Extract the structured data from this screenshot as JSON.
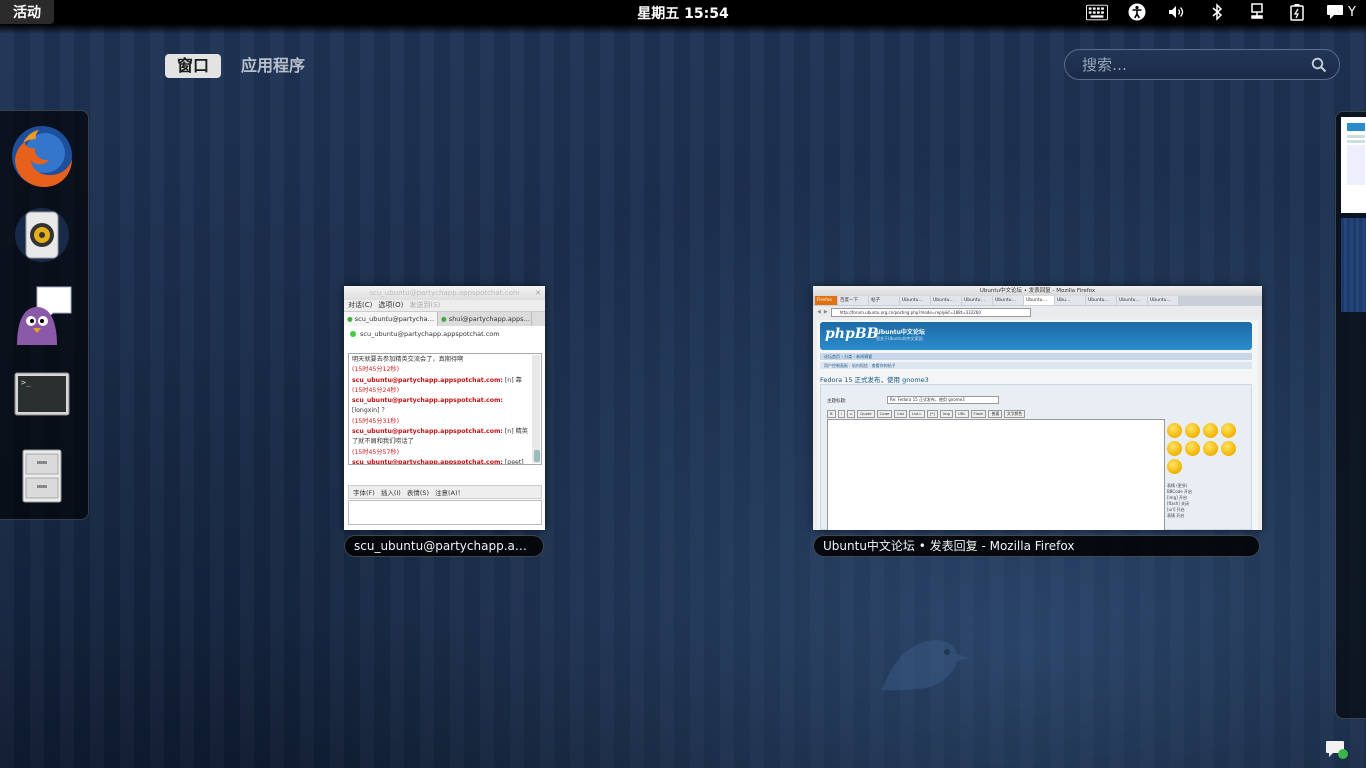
{
  "topbar": {
    "activities": "活动",
    "clock": "星期五 15:54",
    "user": "Y",
    "tray_icons": [
      "keyboard-icon",
      "accessibility-icon",
      "volume-icon",
      "bluetooth-icon",
      "network-icon",
      "battery-icon",
      "chat-status-icon"
    ]
  },
  "view_selector": {
    "windows": "窗口",
    "applications": "应用程序",
    "active": "windows"
  },
  "search": {
    "placeholder": "搜索…"
  },
  "dash": [
    "firefox-icon",
    "rhythmbox-icon",
    "pidgin-icon",
    "terminal-icon",
    "file-manager-icon"
  ],
  "windows": [
    {
      "caption": "scu_ubuntu@partychapp.appsp…",
      "title": "scu_ubuntu@partychapp.appspotchat.com",
      "menu": [
        "对话(C)",
        "选项(O)",
        "发送到(S)"
      ],
      "tabs": [
        "scu_ubuntu@partycha…",
        "shui@partychapp.apps…"
      ],
      "header": "scu_ubuntu@partychapp.appspotchat.com",
      "log": [
        {
          "type": "text",
          "text": "明天就要去参加精英交流会了，真期待啊"
        },
        {
          "type": "ts",
          "text": "(15时45分12秒)"
        },
        {
          "type": "msg",
          "nick": "scu_ubuntu@partychapp.appspotchat.com:",
          "text": " [n] 靠"
        },
        {
          "type": "ts",
          "text": "(15时45分24秒)"
        },
        {
          "type": "msg",
          "nick": "scu_ubuntu@partychapp.appspotchat.com:",
          "text": ""
        },
        {
          "type": "text",
          "text": "[longxin] ？"
        },
        {
          "type": "ts",
          "text": "(15时45分31秒)"
        },
        {
          "type": "msg",
          "nick": "scu_ubuntu@partychapp.appspotchat.com:",
          "text": " [n] 精英"
        },
        {
          "type": "text",
          "text": "了就不屑和我们唠话了"
        },
        {
          "type": "ts",
          "text": "(15时45分57秒)"
        },
        {
          "type": "msg",
          "nick": "scu_ubuntu@partychapp.appspotchat.com:",
          "text": " [peet] 廢"
        },
        {
          "type": "text",
          "text": "話里的精英"
        }
      ],
      "toolbar": [
        "字体(F)",
        "插入(I)",
        "表情(S)",
        "注意(A)！"
      ]
    },
    {
      "caption": "Ubuntu中文论坛 • 发表回复 - Mozilla Firefox",
      "title": "Ubuntu中文论坛 • 发表回复 - Mozilla Firefox",
      "menu_button": "Firefox",
      "tabs": [
        "百度一下",
        "帖子",
        "Ubuntu…",
        "Ubuntu…",
        "Ubuntu…",
        "Ubuntu…",
        "Ubuntu…",
        "Ubu…",
        "Ubuntu…",
        "Ubuntu…",
        "Ubuntu…"
      ],
      "url": "http://forum.ubuntu.org.cn/posting.php?mode=reply&f=188t=332260",
      "logo": "phpBB",
      "forum_name": "Ubuntu中文论坛",
      "forum_sub": "您关于Ubuntu的中文家园",
      "breadcrumb": "论坛首页 ‹ 分类 ‹ 新闻摘要",
      "navbar": "用户控制面板 · 站内短信 · 查看你的帖子",
      "page_title": "Fedora 15 正式发布，使用 gnome3",
      "subject_label": "主题标题:",
      "subject_value": "Re: Fedora 15 正式发布，使用 gnome3",
      "buttons": [
        "B",
        "i",
        "u",
        "Quote",
        "Code",
        "List",
        "List=",
        "[*]",
        "Img",
        "URL",
        "Flash",
        "普通",
        "文字颜色"
      ],
      "side": [
        "表情 (更多)",
        "BBCode 开启",
        "[img] 开启",
        "[flash] 关闭",
        "[url] 开启",
        "表情 开启"
      ]
    }
  ]
}
